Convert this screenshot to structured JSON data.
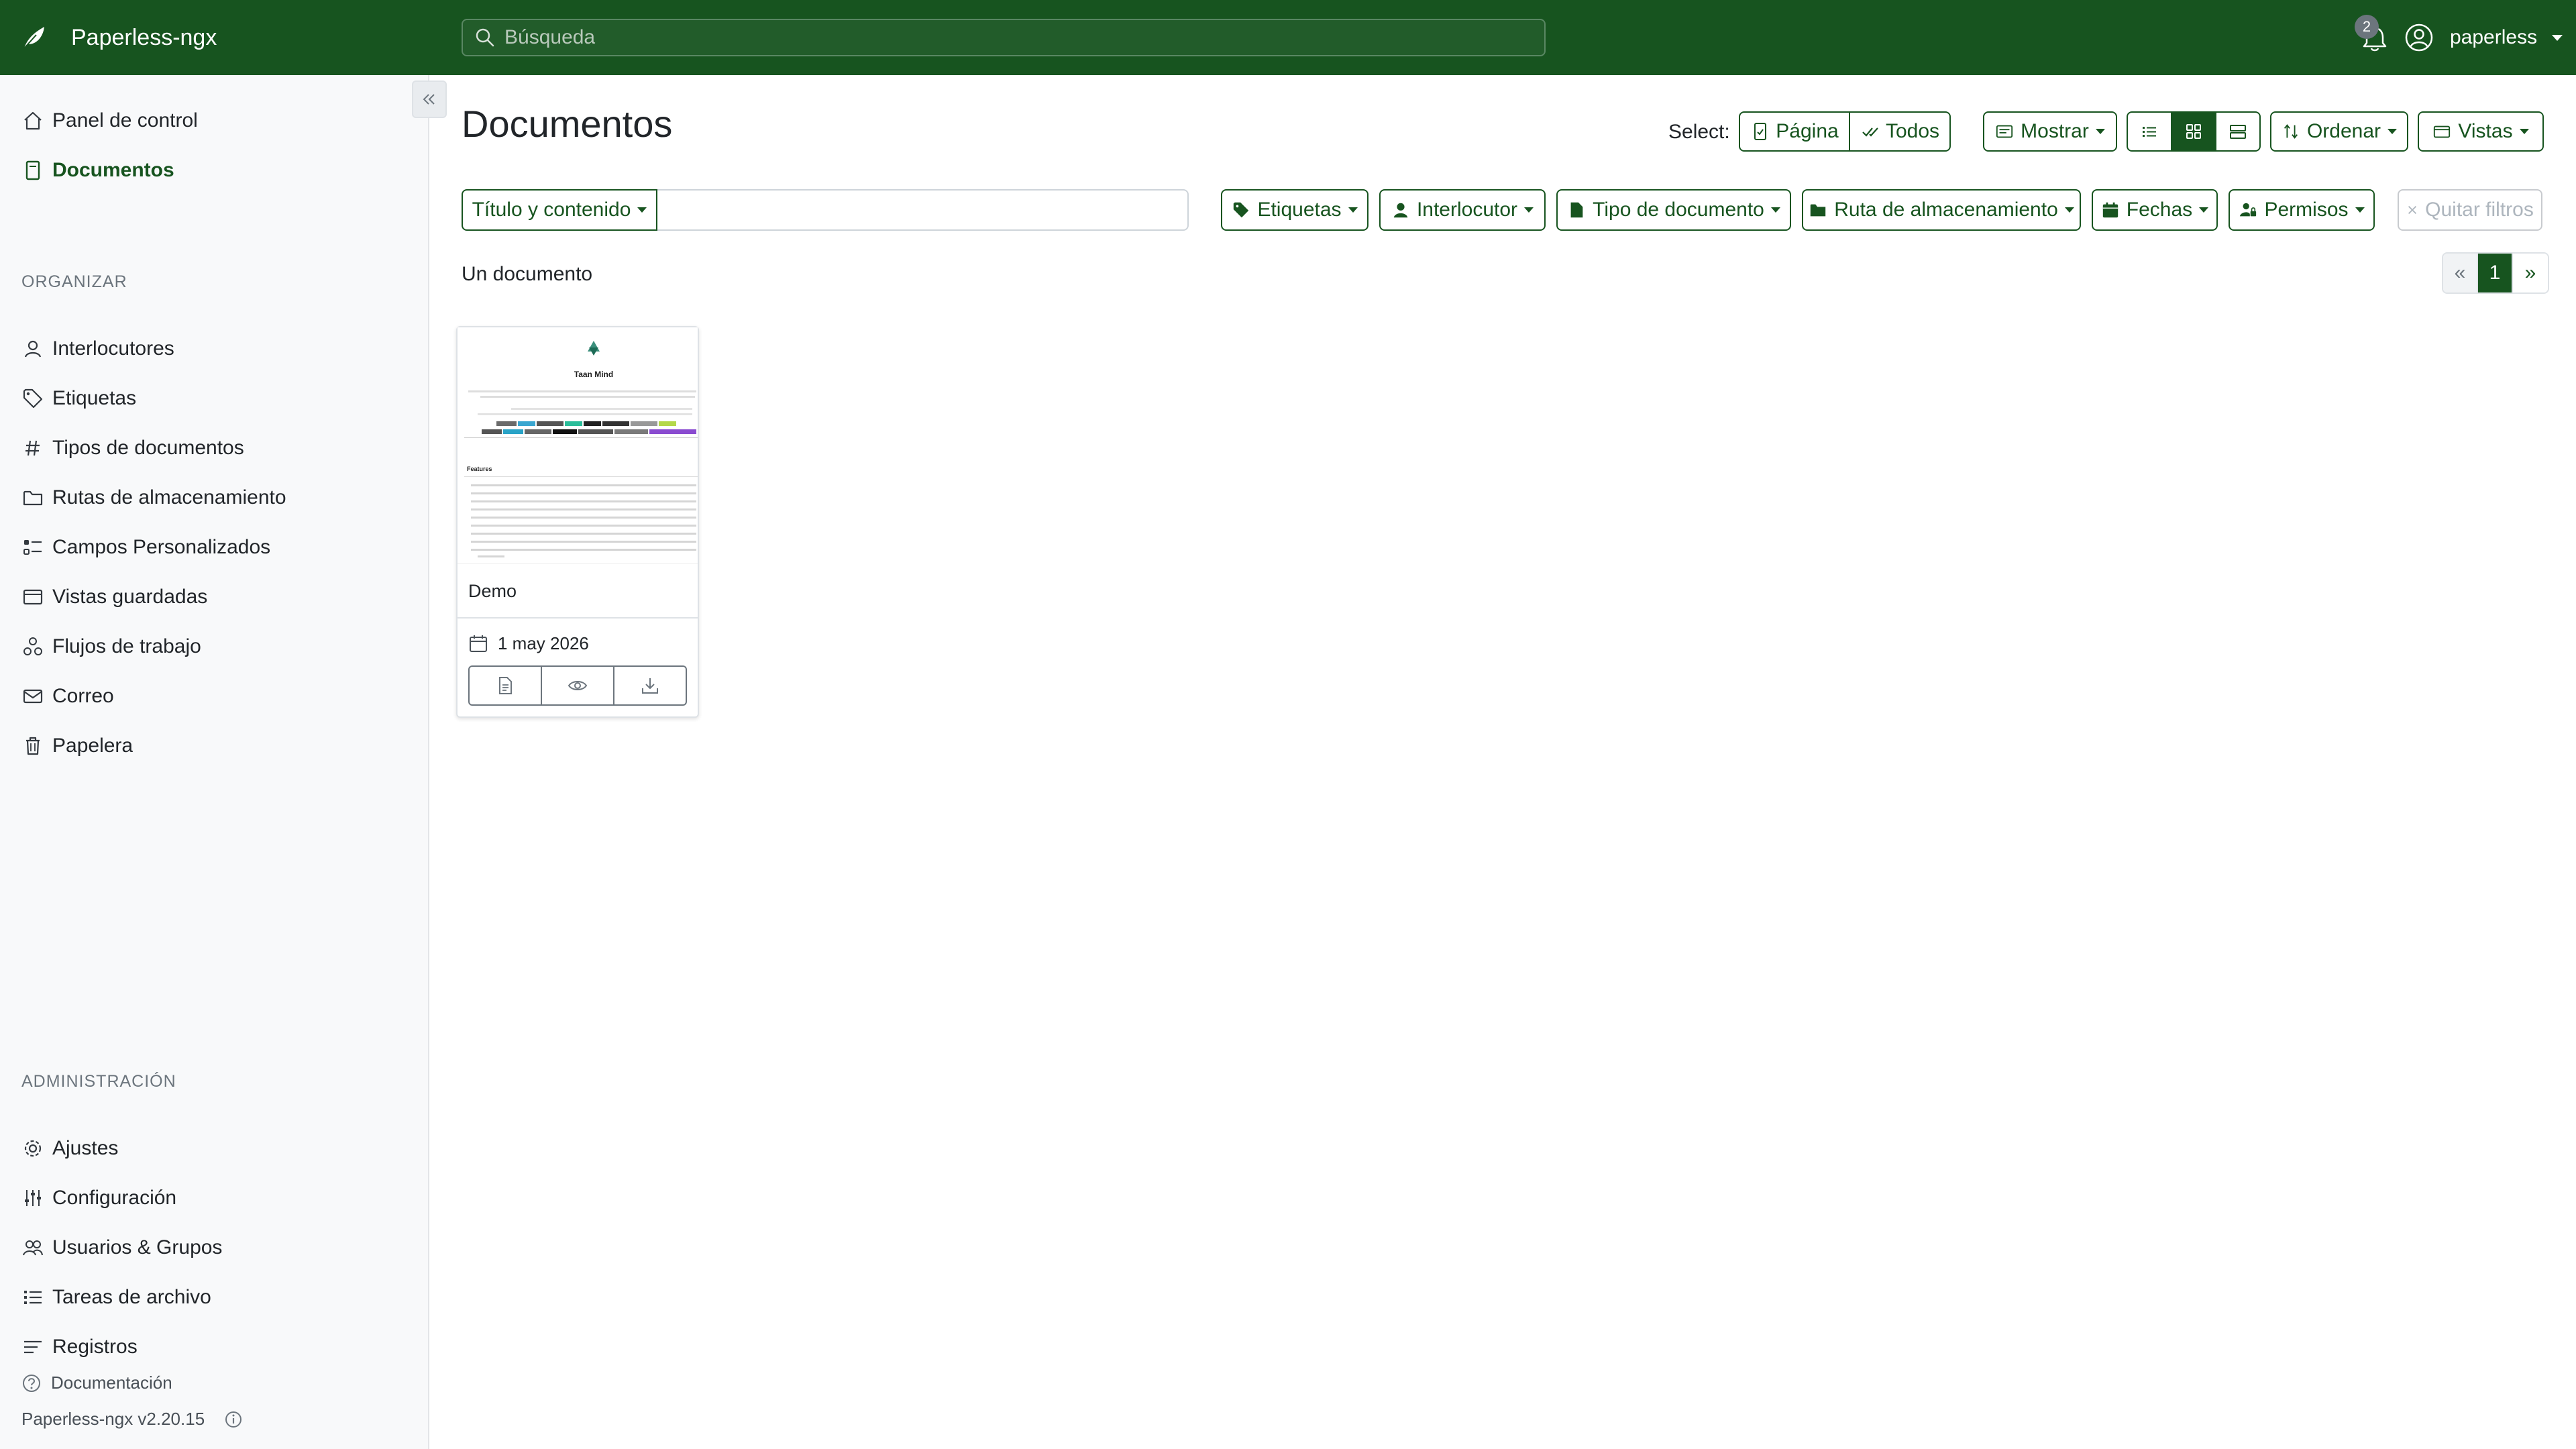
{
  "app": {
    "name": "Paperless-ngx",
    "brand_color": "#17541f"
  },
  "search": {
    "placeholder": "Búsqueda"
  },
  "notifications": {
    "count": "2"
  },
  "user": {
    "name": "paperless"
  },
  "sidebar": {
    "main": [
      {
        "label": "Panel de control",
        "icon": "house-icon"
      },
      {
        "label": "Documentos",
        "icon": "file-icon",
        "active": true
      }
    ],
    "organize_title": "ORGANIZAR",
    "organize": [
      {
        "label": "Interlocutores",
        "icon": "person-icon"
      },
      {
        "label": "Etiquetas",
        "icon": "tag-icon"
      },
      {
        "label": "Tipos de documentos",
        "icon": "hash-icon"
      },
      {
        "label": "Rutas de almacenamiento",
        "icon": "folder-icon"
      },
      {
        "label": "Campos Personalizados",
        "icon": "ui-checks-icon"
      },
      {
        "label": "Vistas guardadas",
        "icon": "window-stack-icon"
      },
      {
        "label": "Flujos de trabajo",
        "icon": "diagram-icon"
      },
      {
        "label": "Correo",
        "icon": "envelope-icon"
      },
      {
        "label": "Papelera",
        "icon": "trash-icon"
      }
    ],
    "admin_title": "ADMINISTRACIÓN",
    "admin": [
      {
        "label": "Ajustes",
        "icon": "gear-icon"
      },
      {
        "label": "Configuración",
        "icon": "sliders-icon"
      },
      {
        "label": "Usuarios & Grupos",
        "icon": "people-icon"
      },
      {
        "label": "Tareas de archivo",
        "icon": "list-task-icon"
      },
      {
        "label": "Registros",
        "icon": "text-lines-icon"
      }
    ],
    "docs_link": "Documentación",
    "version": "Paperless-ngx v2.20.15"
  },
  "main": {
    "title": "Documentos",
    "select_label": "Select:",
    "select_page": "Página",
    "select_all": "Todos",
    "show_label": "Mostrar",
    "sort_label": "Ordenar",
    "views_label": "Vistas",
    "title_filter_label": "Título y contenido",
    "filters": {
      "tags": "Etiquetas",
      "correspondent": "Interlocutor",
      "doc_type": "Tipo de documento",
      "storage_path": "Ruta de almacenamiento",
      "dates": "Fechas",
      "permissions": "Permisos",
      "clear": "Quitar filtros"
    },
    "doc_count": "Un documento",
    "pagination": {
      "prev": "«",
      "current": "1",
      "next": "»"
    }
  },
  "documents": [
    {
      "title": "Demo",
      "date": "1 may 2026",
      "thumb_heading": "Taan Mind",
      "thumb_features": "Features"
    }
  ]
}
